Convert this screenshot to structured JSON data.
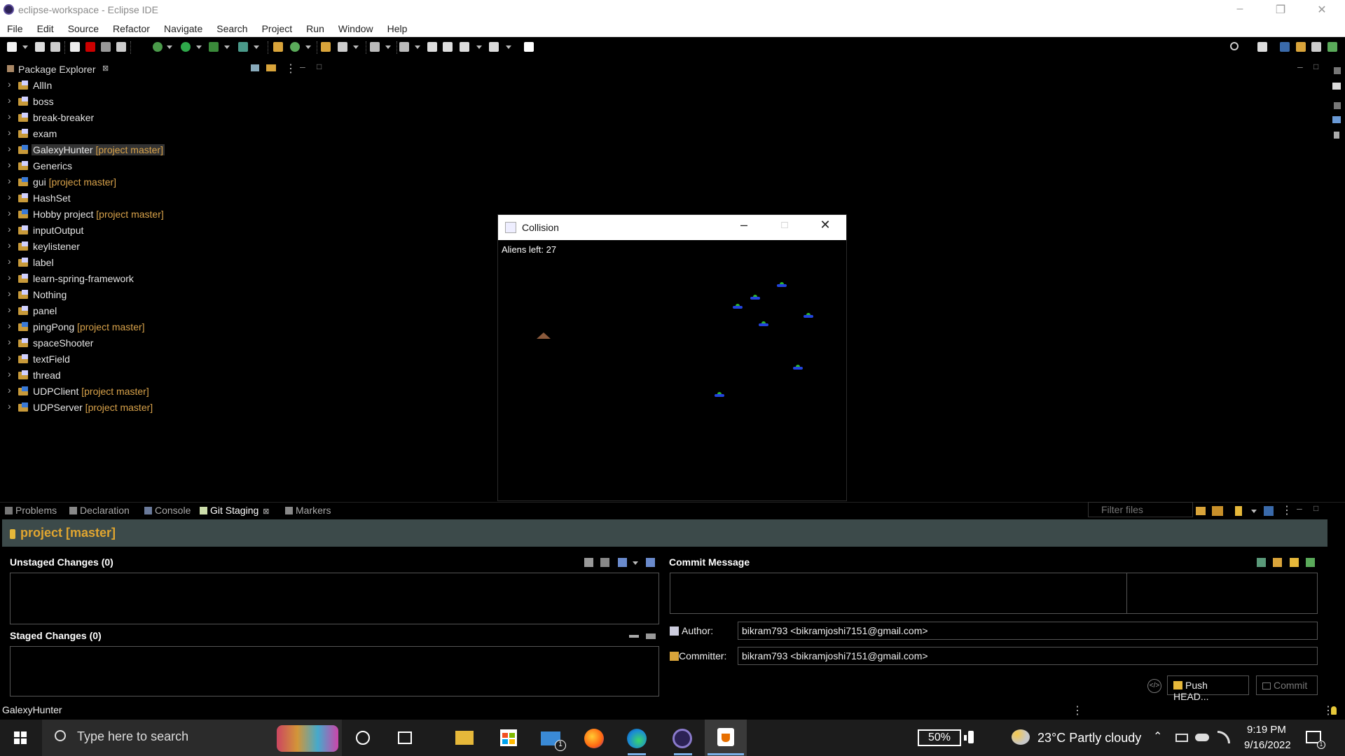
{
  "window": {
    "title": "eclipse-workspace - Eclipse IDE"
  },
  "menu": [
    "File",
    "Edit",
    "Source",
    "Refactor",
    "Navigate",
    "Search",
    "Project",
    "Run",
    "Window",
    "Help"
  ],
  "package_explorer": {
    "title": "Package Explorer",
    "projects": [
      {
        "name": "AllIn",
        "git": ""
      },
      {
        "name": "boss",
        "git": ""
      },
      {
        "name": "break-breaker",
        "git": ""
      },
      {
        "name": "exam",
        "git": ""
      },
      {
        "name": "GalexyHunter",
        "git": " [project master]",
        "selected": true
      },
      {
        "name": "Generics",
        "git": ""
      },
      {
        "name": "gui",
        "git": " [project master]"
      },
      {
        "name": "HashSet",
        "git": ""
      },
      {
        "name": "Hobby project",
        "git": " [project master]"
      },
      {
        "name": "inputOutput",
        "git": ""
      },
      {
        "name": "keylistener",
        "git": ""
      },
      {
        "name": "label",
        "git": ""
      },
      {
        "name": "learn-spring-framework",
        "git": ""
      },
      {
        "name": "Nothing",
        "git": ""
      },
      {
        "name": "panel",
        "git": ""
      },
      {
        "name": "pingPong",
        "git": " [project master]"
      },
      {
        "name": "spaceShooter",
        "git": ""
      },
      {
        "name": "textField",
        "git": ""
      },
      {
        "name": "thread",
        "git": ""
      },
      {
        "name": "UDPClient",
        "git": " [project master]"
      },
      {
        "name": "UDPServer",
        "git": " [project master]"
      }
    ]
  },
  "collision_window": {
    "title": "Collision",
    "aliens_left": "Aliens left: 27"
  },
  "bottom_tabs": [
    {
      "label": "Problems",
      "icon": "problems-icon"
    },
    {
      "label": "Declaration",
      "icon": "declaration-icon"
    },
    {
      "label": "Console",
      "icon": "console-icon"
    },
    {
      "label": "Git Staging",
      "icon": "git-staging-icon",
      "active": true
    },
    {
      "label": "Markers",
      "icon": "markers-icon"
    }
  ],
  "git_staging": {
    "filter_placeholder": "Filter files",
    "repo": "project [master]",
    "unstaged_label": "Unstaged Changes (0)",
    "staged_label": "Staged Changes (0)",
    "commit_message_label": "Commit Message",
    "author_label": "Author:",
    "author_value": "bikram793 <bikramjoshi7151@gmail.com>",
    "committer_label": "Committer:",
    "committer_value": "bikram793 <bikramjoshi7151@gmail.com>",
    "push_label": "Push HEAD...",
    "commit_label": "Commit"
  },
  "status_bar": {
    "text": "GalexyHunter"
  },
  "taskbar": {
    "search_placeholder": "Type here to search",
    "battery": "50%",
    "weather": "23°C  Partly cloudy",
    "time": "9:19 PM",
    "date": "9/16/2022",
    "mail_badge": "1"
  },
  "colors": {
    "git_decoration": "#d8a24a",
    "banner_bg": "#3c4a4a",
    "repo_title": "#e0a530"
  }
}
